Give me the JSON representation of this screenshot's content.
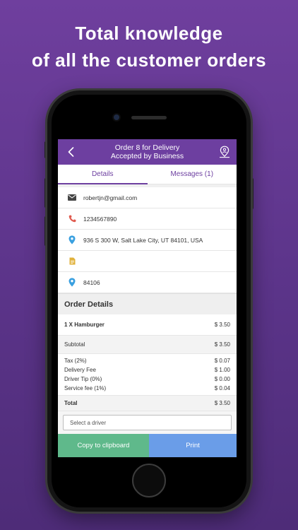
{
  "headline": {
    "line1": "Total knowledge",
    "line2": "of all the customer orders"
  },
  "appbar": {
    "title_line1": "Order 8 for Delivery",
    "title_line2": "Accepted by Business"
  },
  "tabs": [
    {
      "label": "Details",
      "active": true
    },
    {
      "label": "Messages (1)",
      "active": false
    }
  ],
  "customer": {
    "email": "robertjn@gmail.com",
    "phone": "1234567890",
    "address": "936 S 300 W, Salt Lake City, UT 84101, USA",
    "note": "",
    "zip": "84106"
  },
  "order_details": {
    "heading": "Order Details",
    "items": [
      {
        "label": "1 X Hamburger",
        "amount": "$ 3.50"
      }
    ],
    "subtotal": {
      "label": "Subtotal",
      "amount": "$ 3.50"
    },
    "fees": [
      {
        "label": "Tax (2%)",
        "amount": "$ 0.07"
      },
      {
        "label": "Delivery Fee",
        "amount": "$ 1.00"
      },
      {
        "label": "Driver Tip (0%)",
        "amount": "$ 0.00"
      },
      {
        "label": "Service fee (1%)",
        "amount": "$ 0.04"
      }
    ],
    "total": {
      "label": "Total",
      "amount": "$ 3.50"
    }
  },
  "driver_select": {
    "placeholder": "Select a driver"
  },
  "actions": {
    "copy_label": "Copy to clipboard",
    "print_label": "Print"
  },
  "colors": {
    "background": "#6f3f9e",
    "appbar": "#6d3fa0",
    "copy_button": "#5fb98b",
    "print_button": "#6a9de8",
    "phone_icon": "#e05a4e",
    "pin_icon": "#3aa0e0",
    "doc_icon": "#e0b13a"
  }
}
